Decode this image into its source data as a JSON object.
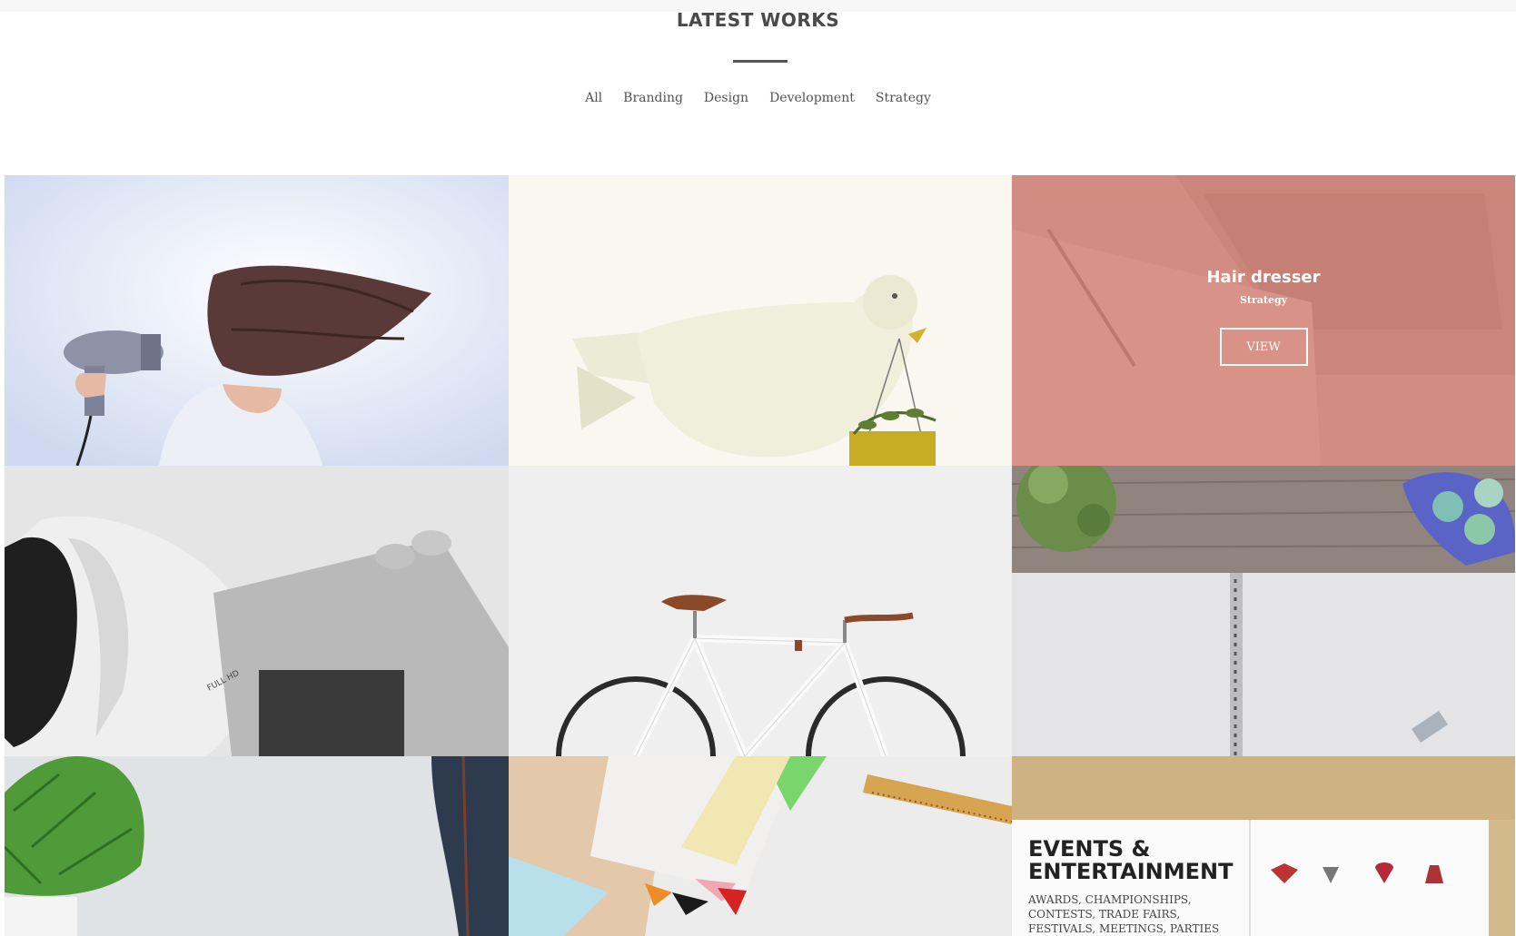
{
  "section": {
    "title": "LATEST WORKS"
  },
  "filters": [
    "All",
    "Branding",
    "Design",
    "Development",
    "Strategy"
  ],
  "portfolio": {
    "hover_item": {
      "title": "Hair dresser",
      "category": "Strategy",
      "button_label": "VIEW"
    },
    "poster": {
      "heading_line1": "EVENTS &",
      "heading_line2": "ENTERTAINMENT",
      "sub_line1": "AWARDS, CHAMPIONSHIPS,",
      "sub_line2": "CONTESTS, TRADE FAIRS,",
      "sub_line3": "FESTIVALS, MEETINGS, PARTIES"
    },
    "camera_badge": "FULL HD"
  },
  "colors": {
    "overlay": "#d68074",
    "title_text": "#4a4a4a",
    "filter_text": "#555555"
  }
}
